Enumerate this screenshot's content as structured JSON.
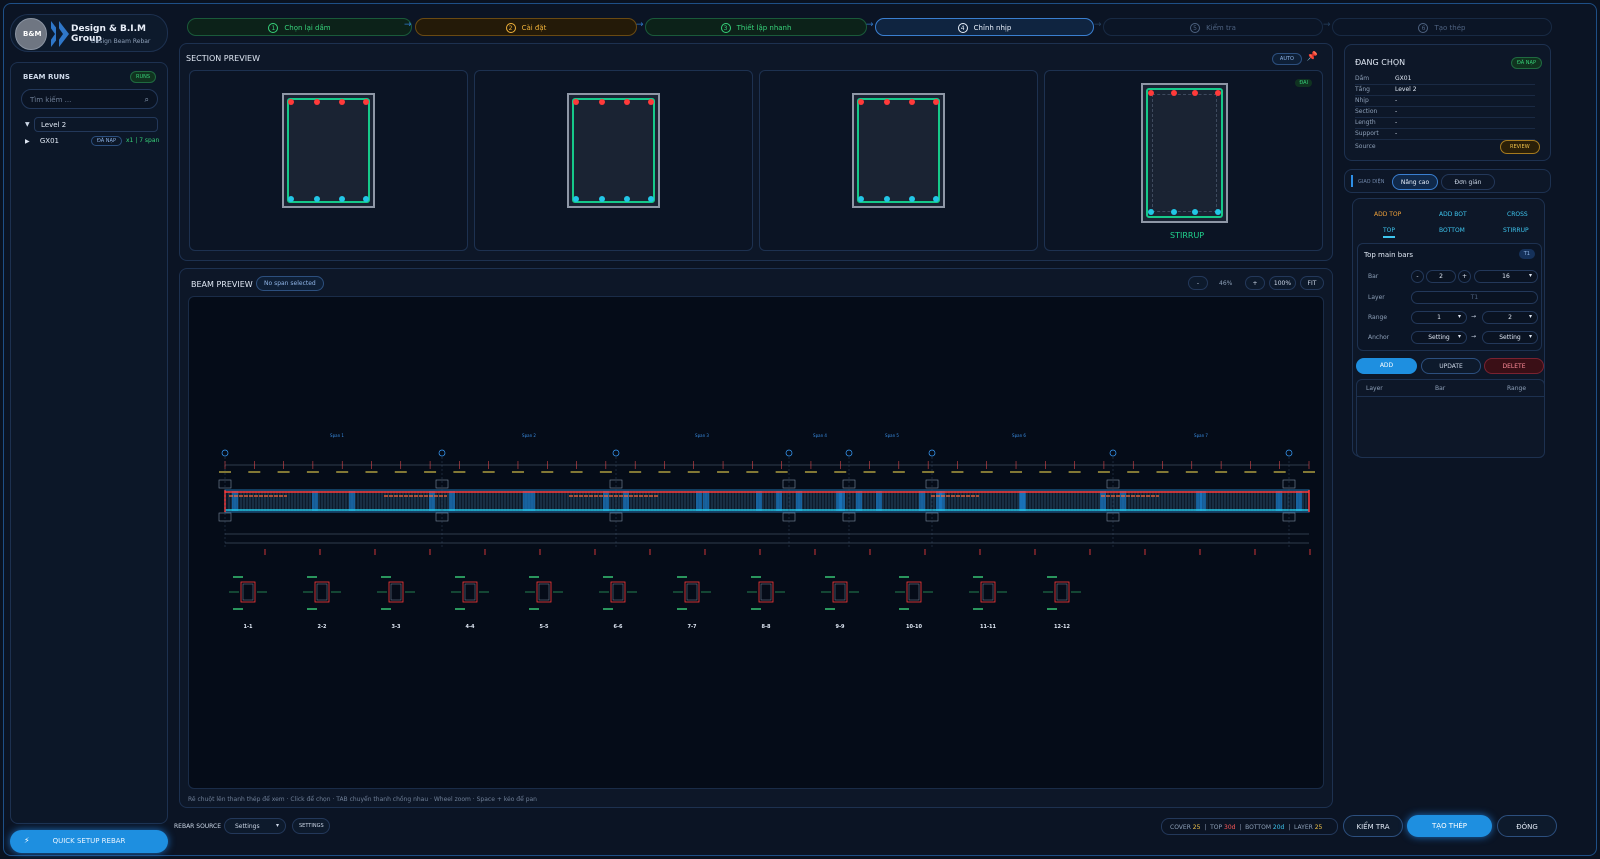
{
  "brand": {
    "title": "Design & B.I.M Group",
    "subtitle": "Design Beam Rebar",
    "logo_text": "B&M"
  },
  "steps": [
    {
      "num": "1",
      "label": "Chọn lại dầm"
    },
    {
      "num": "2",
      "label": "Cài đặt"
    },
    {
      "num": "3",
      "label": "Thiết lập nhanh"
    },
    {
      "num": "4",
      "label": "Chỉnh nhịp"
    },
    {
      "num": "5",
      "label": "Kiểm tra"
    },
    {
      "num": "6",
      "label": "Tạo thép"
    }
  ],
  "left": {
    "title": "BEAM RUNS",
    "badge": "RUNS",
    "search_placeholder": "Tìm kiếm ...",
    "level": "Level 2",
    "beam": {
      "name": "GX01",
      "status": "ĐÃ NẠP",
      "info": "x1 | 7 span"
    },
    "quick_setup": "QUICK SETUP REBAR"
  },
  "section_preview": {
    "title": "SECTION PREVIEW",
    "mode": "AUTO",
    "stirrup_label": "STIRRUP",
    "dai_label": "ĐAI"
  },
  "beam_preview": {
    "title": "BEAM PREVIEW",
    "status": "No span selected",
    "zoom_out": "-",
    "zoom_value": "46%",
    "zoom_in": "+",
    "reset": "100%",
    "fit": "FIT",
    "hint": "Rê chuột lên thanh thép để xem · Click để chọn · TAB chuyển thanh chồng nhau · Wheel zoom · Space + kéo để pan",
    "spans": [
      "Span 1",
      "Span 2",
      "Span 3",
      "Span 4",
      "Span 5",
      "Span 6",
      "Span 7"
    ],
    "section_labels": [
      "1-1",
      "2-2",
      "3-3",
      "4-4",
      "5-5",
      "6-6",
      "7-7",
      "8-8",
      "9-9",
      "10-10",
      "11-11",
      "12-12"
    ]
  },
  "bottom": {
    "rebar_source_label": "REBAR SOURCE",
    "rebar_source_value": "Settings",
    "settings_button": "SETTINGS",
    "stats": {
      "cover_label": "COVER",
      "cover": "25",
      "top_label": "TOP",
      "top": "30d",
      "bottom_label": "BOTTOM",
      "bottom": "20d",
      "layer_label": "LAYER",
      "layer": "25"
    },
    "check_button": "KIỂM TRA",
    "create_button": "TẠO THÉP",
    "close_button": "ĐÓNG"
  },
  "right": {
    "selected_title": "ĐANG CHỌN",
    "selected_badge": "ĐÃ NẠP",
    "fields": [
      {
        "k": "Dầm",
        "v": "GX01"
      },
      {
        "k": "Tầng",
        "v": "Level 2"
      },
      {
        "k": "Nhịp",
        "v": "-"
      },
      {
        "k": "Section",
        "v": "-"
      },
      {
        "k": "Length",
        "v": "-"
      },
      {
        "k": "Support",
        "v": "-"
      }
    ],
    "source_label": "Source",
    "source_value": "REVIEW",
    "ui_label": "GIAO DIỆN",
    "mode_advanced": "Nâng cao",
    "mode_simple": "Đơn giản",
    "tabs_row1": [
      "ADD TOP",
      "ADD BOT",
      "CROSS"
    ],
    "tabs_row2": [
      "TOP",
      "BOTTOM",
      "STIRRUP"
    ],
    "group_title": "Top main bars",
    "group_badge": "T1",
    "bar_label": "Bar",
    "bar_minus": "-",
    "bar_count": "2",
    "bar_plus": "+",
    "bar_dia": "16",
    "layer_label": "Layer",
    "layer_value": "T1",
    "range_label": "Range",
    "range_from": "1",
    "range_to": "2",
    "anchor_label": "Anchor",
    "anchor_start": "Setting",
    "anchor_end": "Setting",
    "arrow": "→",
    "add_btn": "ADD",
    "update_btn": "UPDATE",
    "delete_btn": "DELETE",
    "table_headers": [
      "Layer",
      "Bar",
      "Range"
    ]
  }
}
